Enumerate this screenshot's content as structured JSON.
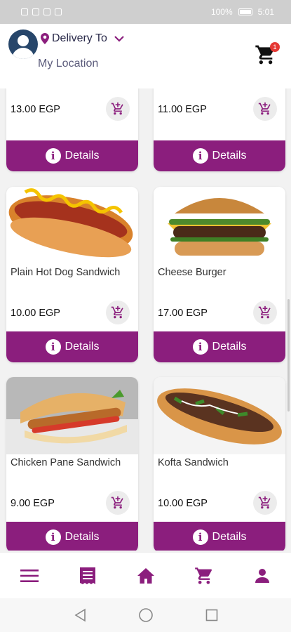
{
  "status_bar": {
    "battery": "100%",
    "time": "5:01"
  },
  "header": {
    "delivery_label": "Delivery To",
    "location": "My Location",
    "cart_count": "1"
  },
  "products": [
    {
      "name": "",
      "price": "13.00 EGP",
      "details_label": "Details"
    },
    {
      "name": "",
      "price": "11.00 EGP",
      "details_label": "Details"
    },
    {
      "name": "Plain Hot Dog Sandwich",
      "price": "10.00 EGP",
      "details_label": "Details"
    },
    {
      "name": "Cheese Burger",
      "price": "17.00 EGP",
      "details_label": "Details"
    },
    {
      "name": "Chicken Pane Sandwich",
      "price": "9.00 EGP",
      "details_label": "Details"
    },
    {
      "name": "Kofta Sandwich",
      "price": "10.00 EGP",
      "details_label": "Details"
    }
  ],
  "bottom_nav": [
    {
      "icon": "menu-icon"
    },
    {
      "icon": "receipt-icon"
    },
    {
      "icon": "home-icon"
    },
    {
      "icon": "cart-icon"
    },
    {
      "icon": "profile-icon"
    }
  ],
  "colors": {
    "accent": "#8b1e7d",
    "badge": "#e53935"
  }
}
